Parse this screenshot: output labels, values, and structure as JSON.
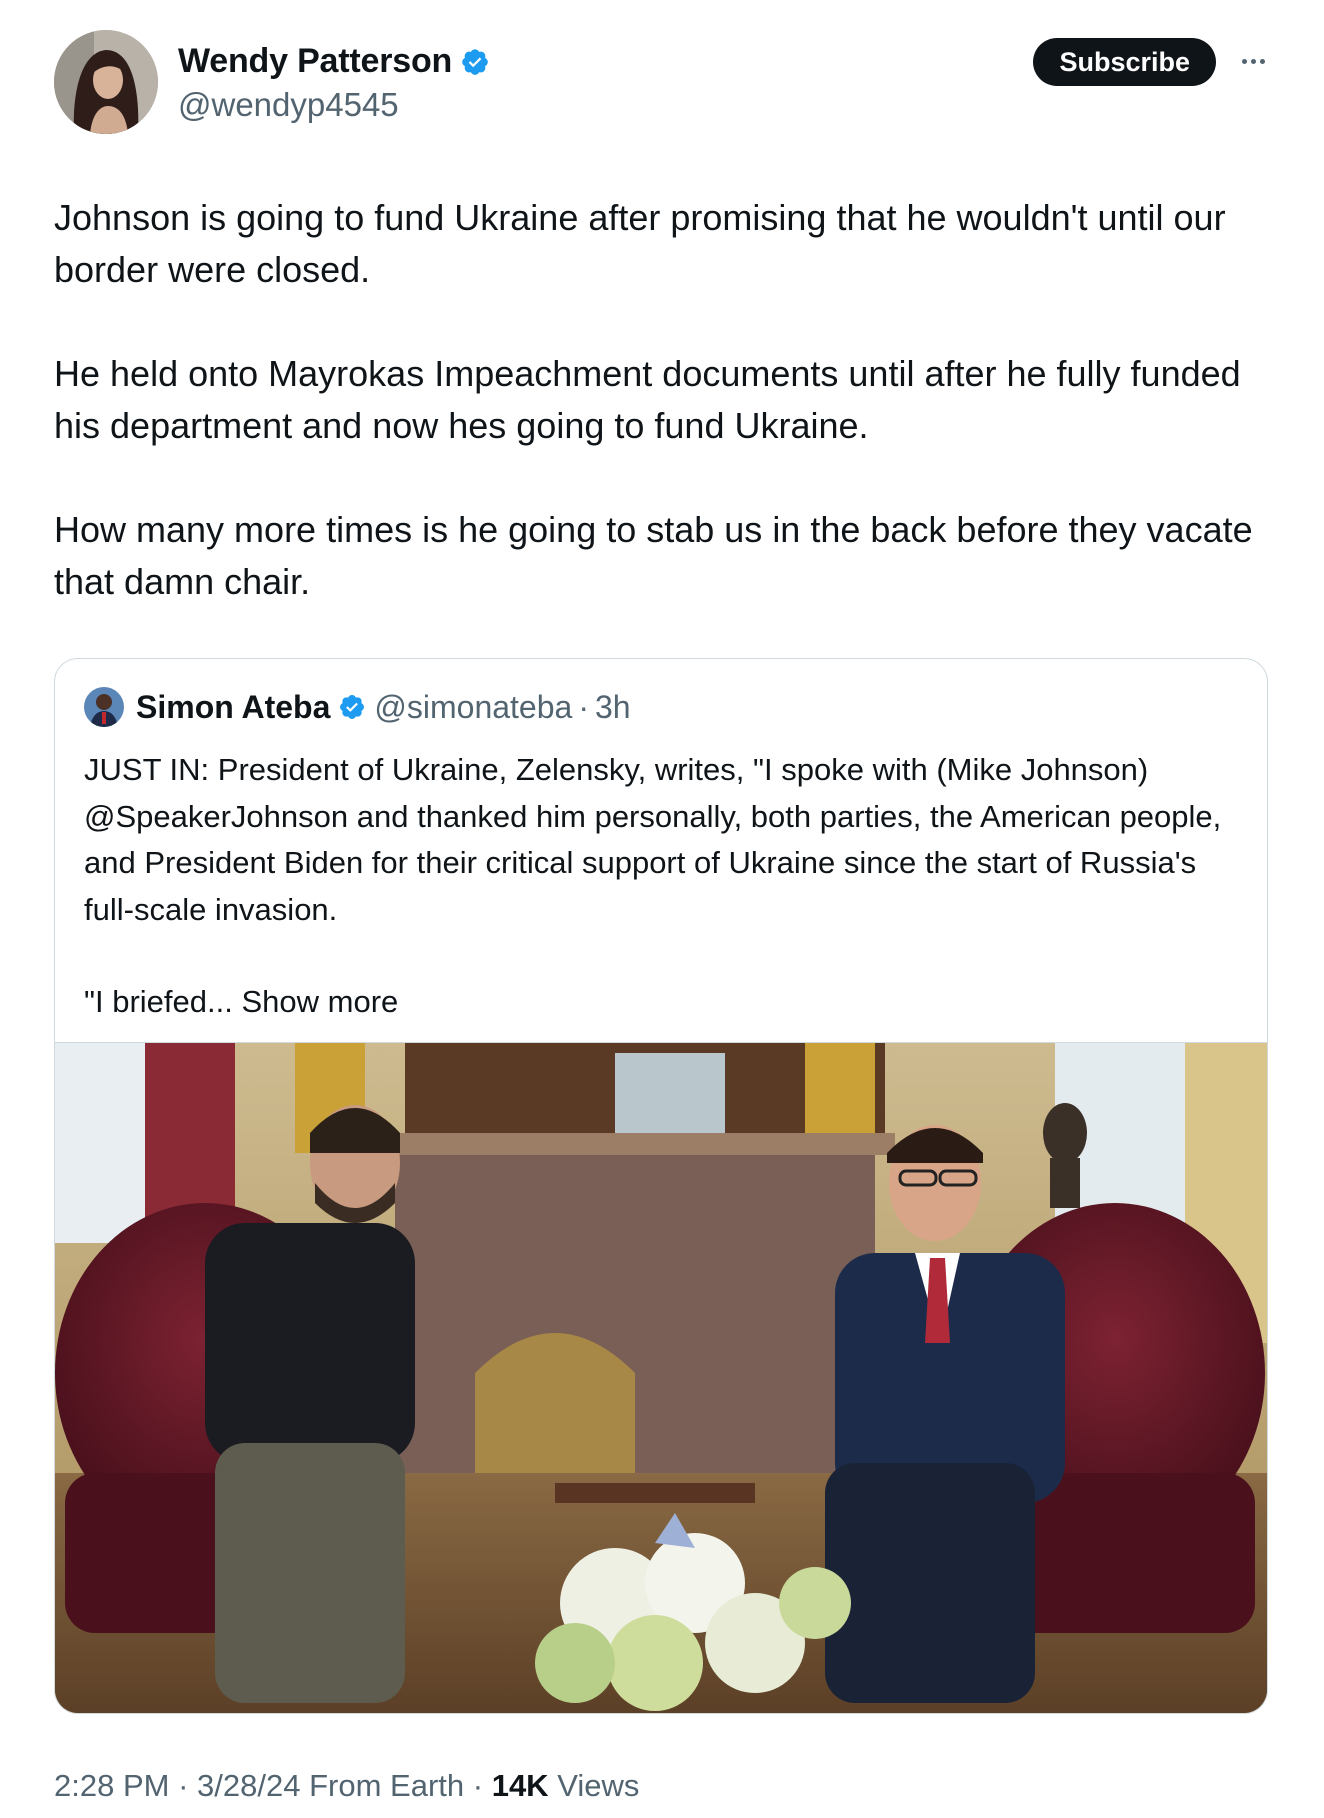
{
  "author": {
    "display_name": "Wendy Patterson",
    "handle": "@wendyp4545",
    "verified": true
  },
  "actions": {
    "subscribe_label": "Subscribe"
  },
  "post": {
    "paragraphs": [
      "Johnson is going to fund Ukraine after promising that he wouldn't until our border were closed.",
      "He held onto Mayrokas Impeachment documents until after he fully funded his department and now hes going to fund Ukraine.",
      "How many more times is he going to stab us in the back before they vacate that damn chair."
    ]
  },
  "quote": {
    "display_name": "Simon Ateba",
    "handle": "@simonateba",
    "separator": "·",
    "time": "3h",
    "paragraph_1": "JUST IN: President of Ukraine, Zelensky, writes, \"I spoke with (Mike Johnson) @SpeakerJohnson and thanked him personally, both parties, the American people, and President Biden for their critical support of Ukraine since the start of Russia's full-scale invasion.",
    "paragraph_2": "\"I briefed...",
    "show_more": "Show more"
  },
  "footer": {
    "time": "2:28 PM",
    "date": "3/28/24",
    "source": "From Earth",
    "views_count": "14K",
    "views_label": "Views",
    "separator": "·"
  },
  "colors": {
    "text": "#0f1419",
    "secondary": "#536471",
    "verified": "#1d9bf0",
    "border": "#cfd9de"
  }
}
